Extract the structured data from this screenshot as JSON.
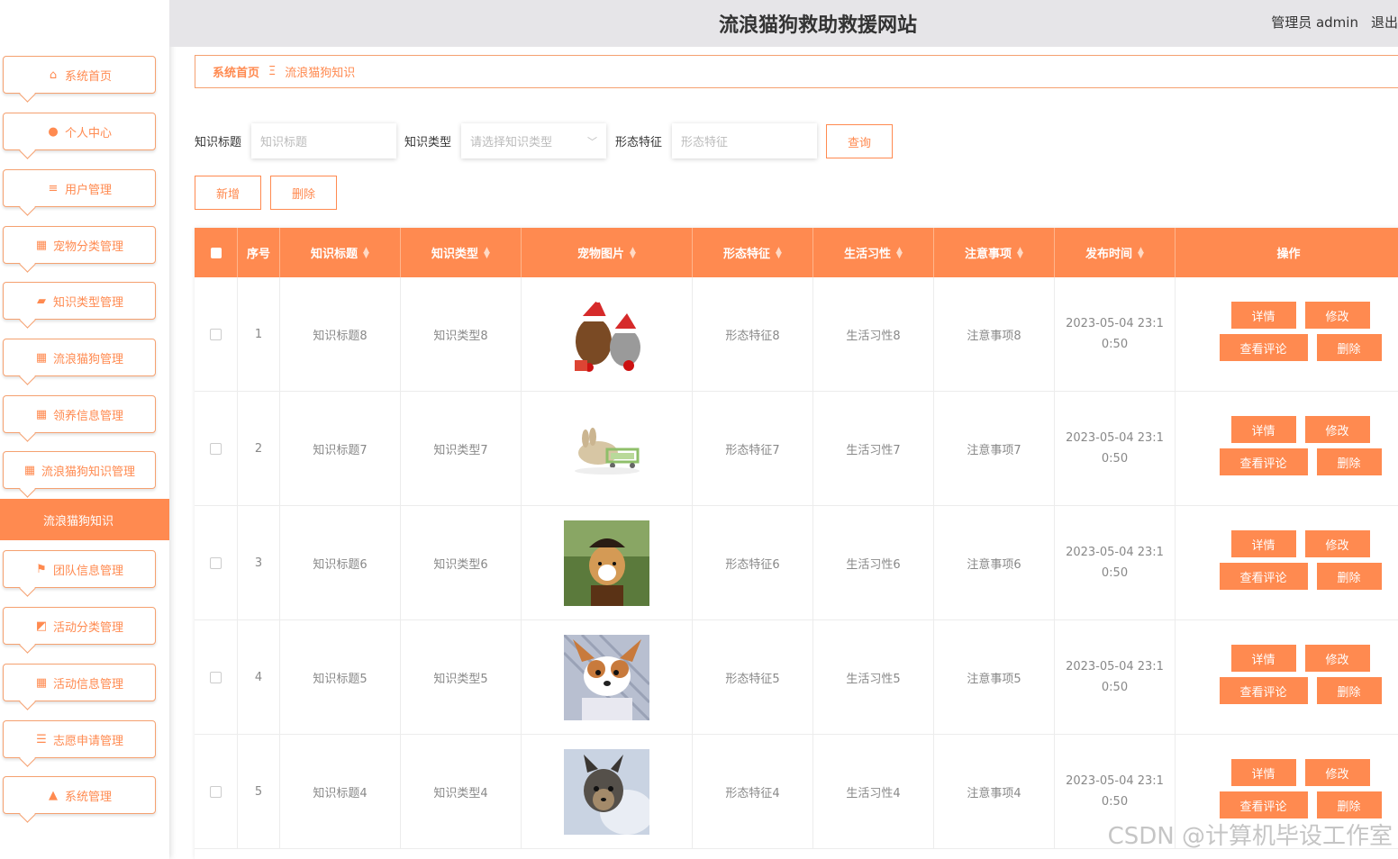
{
  "header": {
    "title": "流浪猫狗救助救援网站",
    "user": "管理员 admin",
    "logout": "退出"
  },
  "sidebar": {
    "items": [
      {
        "label": "系统首页",
        "icon": "home-icon"
      },
      {
        "label": "个人中心",
        "icon": "user-icon"
      },
      {
        "label": "用户管理",
        "icon": "sliders-icon"
      },
      {
        "label": "宠物分类管理",
        "icon": "grid-icon"
      },
      {
        "label": "知识类型管理",
        "icon": "wallet-icon"
      },
      {
        "label": "流浪猫狗管理",
        "icon": "grid-icon"
      },
      {
        "label": "领养信息管理",
        "icon": "grid-icon"
      },
      {
        "label": "流浪猫狗知识管理",
        "icon": "grid-icon"
      }
    ],
    "active_sub": "流浪猫狗知识",
    "items_after": [
      {
        "label": "团队信息管理",
        "icon": "flag-icon"
      },
      {
        "label": "活动分类管理",
        "icon": "chart-icon"
      },
      {
        "label": "活动信息管理",
        "icon": "grid-icon"
      },
      {
        "label": "志愿申请管理",
        "icon": "list-icon"
      },
      {
        "label": "系统管理",
        "icon": "person-icon"
      }
    ]
  },
  "breadcrumb": {
    "home": "系统首页",
    "separator": "Ξ",
    "current": "流浪猫狗知识"
  },
  "search": {
    "title_label": "知识标题",
    "title_placeholder": "知识标题",
    "type_label": "知识类型",
    "type_placeholder": "请选择知识类型",
    "feature_label": "形态特征",
    "feature_placeholder": "形态特征",
    "query_button": "查询"
  },
  "actions": {
    "add": "新增",
    "delete": "删除"
  },
  "table": {
    "columns": [
      "序号",
      "知识标题",
      "知识类型",
      "宠物图片",
      "形态特征",
      "生活习性",
      "注意事项",
      "发布时间",
      "操作"
    ],
    "rows": [
      {
        "no": "1",
        "title": "知识标题8",
        "type": "知识类型8",
        "feature": "形态特征8",
        "habit": "生活习性8",
        "note": "注意事项8",
        "time": "2023-05-04 23:10:50",
        "pic": "christmas-dog-cat"
      },
      {
        "no": "2",
        "title": "知识标题7",
        "type": "知识类型7",
        "feature": "形态特征7",
        "habit": "生活习性7",
        "note": "注意事项7",
        "time": "2023-05-04 23:10:50",
        "pic": "rabbit-cart"
      },
      {
        "no": "3",
        "title": "知识标题6",
        "type": "知识类型6",
        "feature": "形态特征6",
        "habit": "生活习性6",
        "note": "注意事项6",
        "time": "2023-05-04 23:10:50",
        "pic": "corgi-pirate"
      },
      {
        "no": "4",
        "title": "知识标题5",
        "type": "知识类型5",
        "feature": "形态特征5",
        "habit": "生活习性5",
        "note": "注意事项5",
        "time": "2023-05-04 23:10:50",
        "pic": "chihuahua"
      },
      {
        "no": "5",
        "title": "知识标题4",
        "type": "知识类型4",
        "feature": "形态特征4",
        "habit": "生活习性4",
        "note": "注意事项4",
        "time": "2023-05-04 23:10:50",
        "pic": "puppy-yorkie"
      }
    ],
    "row_buttons": {
      "detail": "详情",
      "edit": "修改",
      "comments": "查看评论",
      "delete": "删除"
    }
  },
  "watermark": "CSDN @计算机毕设工作室",
  "colors": {
    "accent": "#ff8a50",
    "header_bg": "#e6e5e8",
    "border": "#f5a170"
  }
}
